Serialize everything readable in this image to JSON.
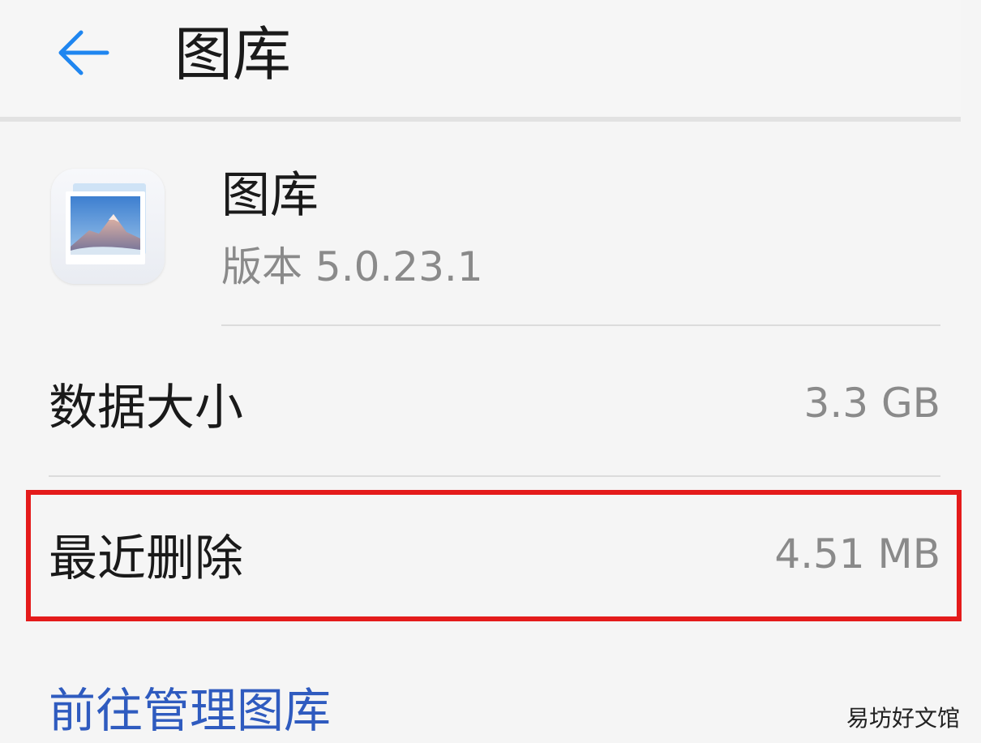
{
  "header": {
    "title": "图库",
    "back_icon": "arrow-left-icon",
    "back_icon_color": "#1f86f0"
  },
  "app_info": {
    "name": "图库",
    "version": "版本 5.0.23.1",
    "icon": "gallery-app-icon"
  },
  "storage": {
    "rows": [
      {
        "label": "数据大小",
        "value": "3.3 GB"
      },
      {
        "label": "最近删除",
        "value": "4.51 MB"
      }
    ],
    "highlight_color": "#e41b1b"
  },
  "actions": {
    "manage_label": "前往管理图库",
    "manage_color": "#2f5bbf"
  },
  "watermark": {
    "text": "易坊好文馆"
  }
}
